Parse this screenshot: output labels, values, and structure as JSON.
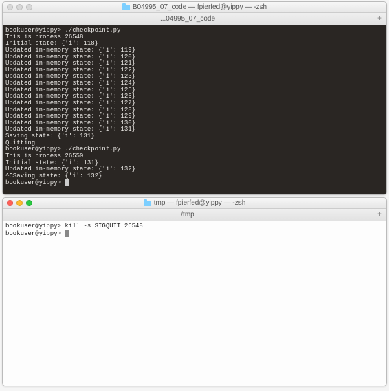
{
  "window_top": {
    "title": "B04995_07_code — fpierfed@yippy — -zsh",
    "tab": "...04995_07_code",
    "terminal_lines": [
      "bookuser@yippy> ./checkpoint.py",
      "This is process 26548",
      "Initial state: {'i': 118}",
      "Updated in-memory state: {'i': 119}",
      "Updated in-memory state: {'i': 120}",
      "Updated in-memory state: {'i': 121}",
      "Updated in-memory state: {'i': 122}",
      "Updated in-memory state: {'i': 123}",
      "Updated in-memory state: {'i': 124}",
      "Updated in-memory state: {'i': 125}",
      "Updated in-memory state: {'i': 126}",
      "Updated in-memory state: {'i': 127}",
      "Updated in-memory state: {'i': 128}",
      "Updated in-memory state: {'i': 129}",
      "Updated in-memory state: {'i': 130}",
      "Updated in-memory state: {'i': 131}",
      "Saving state: {'i': 131}",
      "Quitting",
      "bookuser@yippy> ./checkpoint.py",
      "This is process 26559",
      "Initial state: {'i': 131}",
      "Updated in-memory state: {'i': 132}",
      "^CSaving state: {'i': 132}",
      "bookuser@yippy> "
    ]
  },
  "window_bottom": {
    "title": "tmp — fpierfed@yippy — -zsh",
    "tab": "/tmp",
    "terminal_lines": [
      "bookuser@yippy> kill -s SIGQUIT 26548",
      "bookuser@yippy> "
    ]
  },
  "plus": "+"
}
